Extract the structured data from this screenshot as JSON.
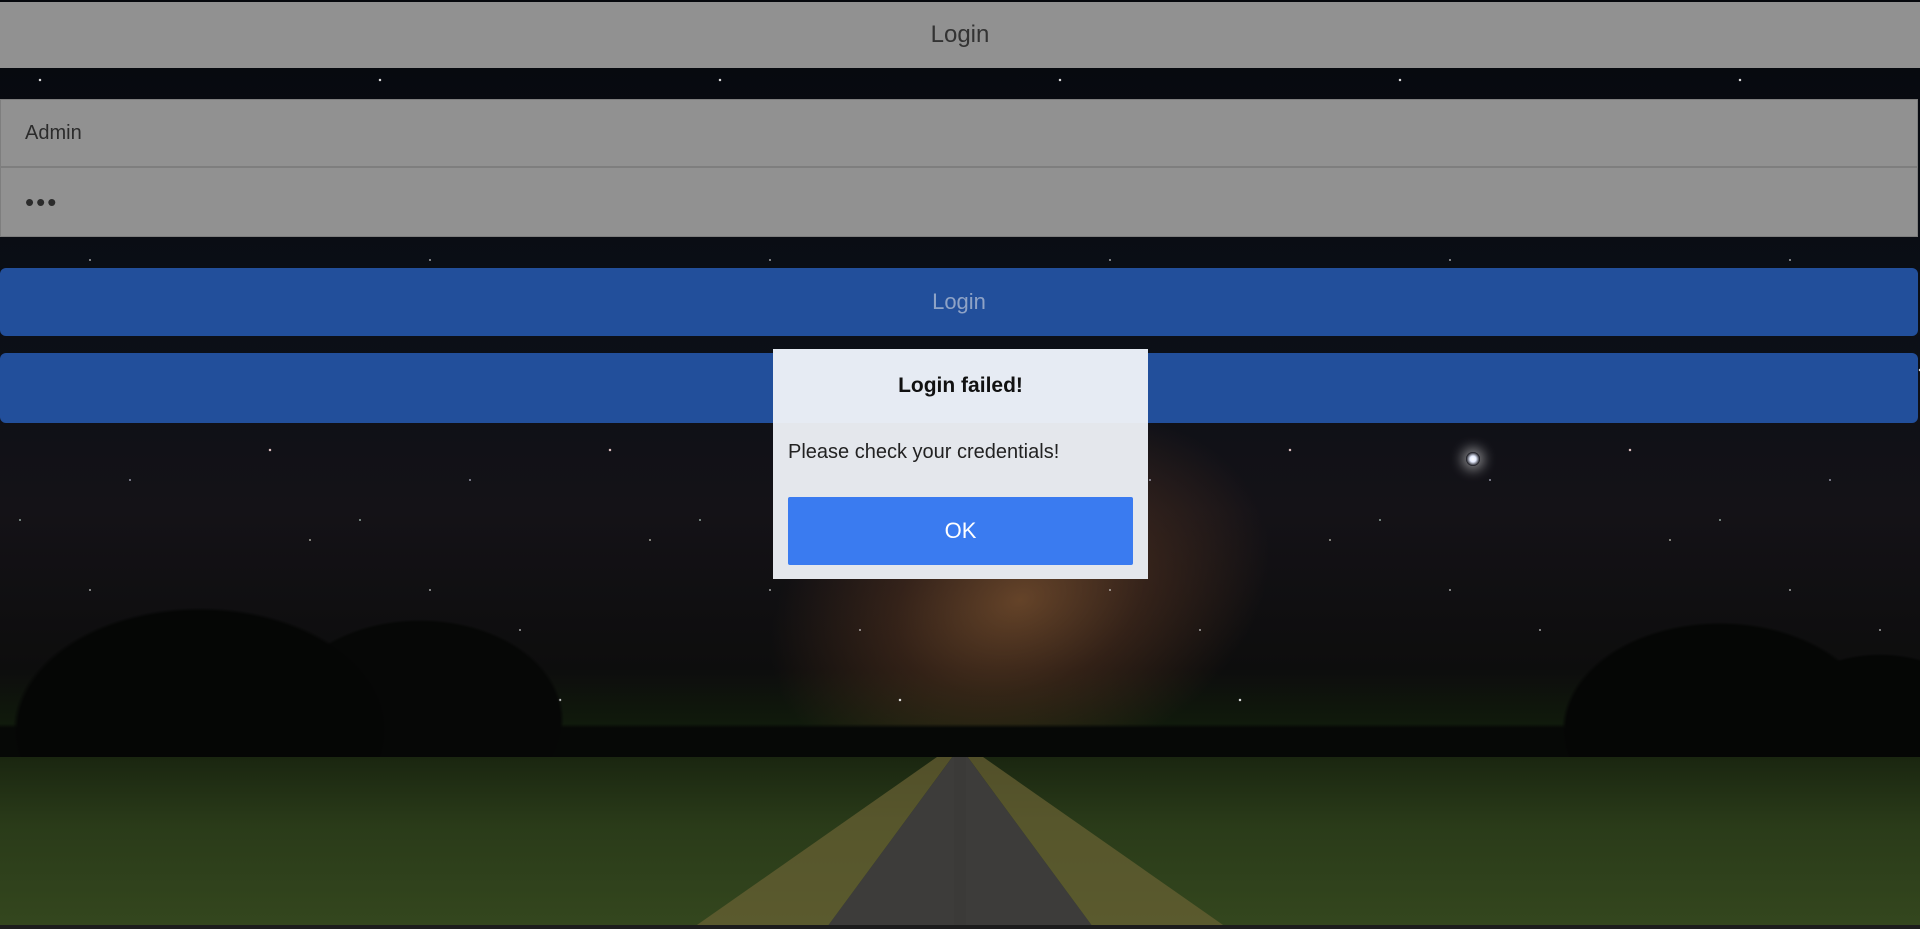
{
  "header": {
    "title": "Login"
  },
  "form": {
    "username_value": "Admin",
    "password_value": "•••",
    "login_button_label": "Login",
    "second_button_label": ""
  },
  "dialog": {
    "title": "Login failed!",
    "message": "Please check your credentials!",
    "ok_label": "OK"
  },
  "colors": {
    "primary_button": "#224f9b",
    "dialog_button": "#3a7bf0",
    "bar_gray": "#919191"
  }
}
